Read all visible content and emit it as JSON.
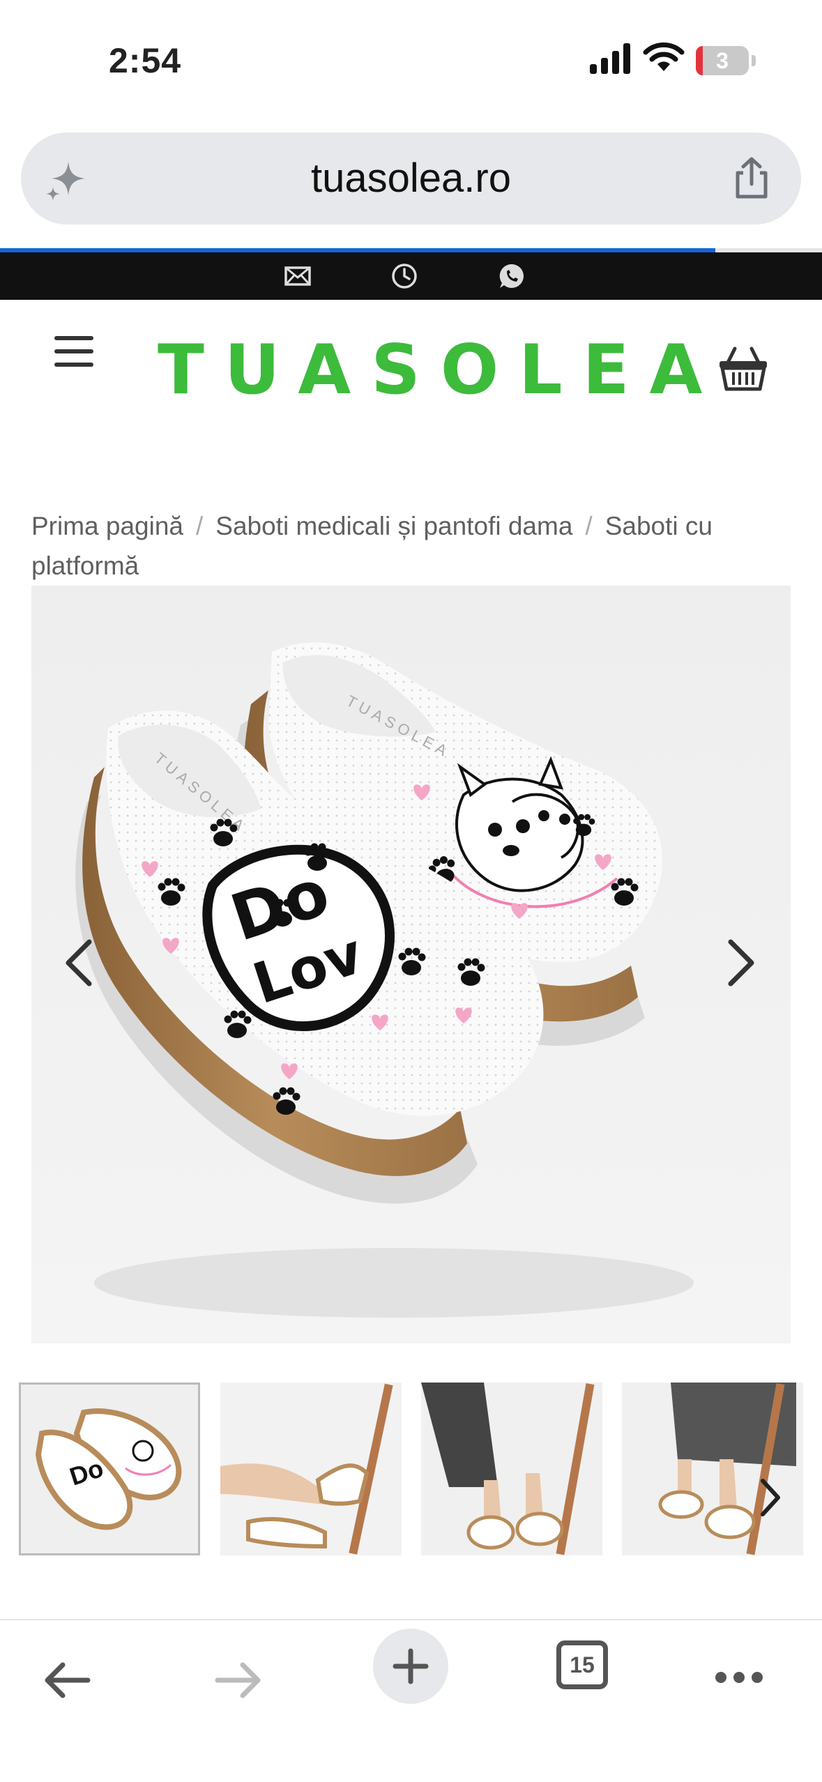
{
  "status": {
    "time": "2:54",
    "battery": "3"
  },
  "browser": {
    "url": "tuasolea.ro",
    "tab_count": "15",
    "load_progress": 0.87
  },
  "site": {
    "logo": "TUASOLEA",
    "contact_icons": [
      "mail-icon",
      "clock-icon",
      "whatsapp-icon"
    ]
  },
  "breadcrumb": {
    "items": [
      "Prima pagină",
      "Saboti medicali și pantofi dama",
      "Saboti cu platformă"
    ],
    "separator": "/"
  },
  "gallery": {
    "main_image": "white platform clogs with DOG LOVER print, paw prints and pink hearts, wooden-look sole",
    "thumbnails": 4,
    "active_thumbnail": 0
  },
  "colors": {
    "brand_green": "#3dbb3b",
    "top_strip": "#111111",
    "progress": "#1565d8"
  }
}
